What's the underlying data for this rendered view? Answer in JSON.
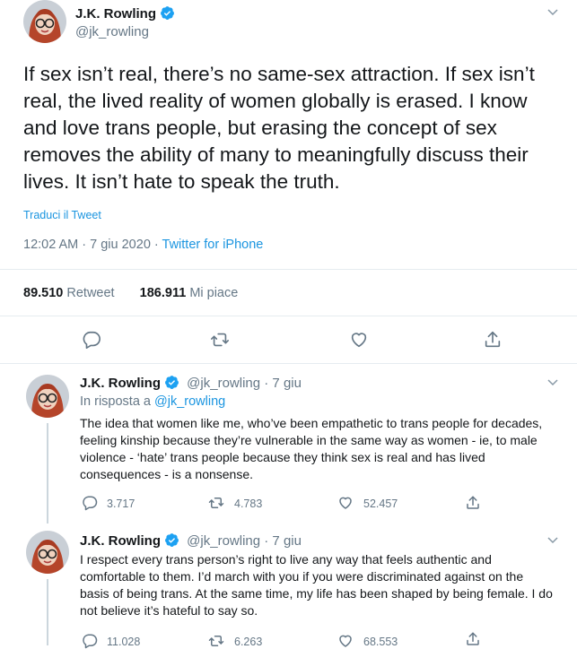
{
  "main_tweet": {
    "author_name": "J.K. Rowling",
    "author_handle": "@jk_rowling",
    "text": "If sex isn’t real, there’s no same-sex attraction. If sex isn’t real, the lived reality of women globally is erased. I know and love trans people, but erasing the concept of sex removes the ability of many to meaningfully discuss their lives. It isn’t hate to speak the truth.",
    "translate_label": "Traduci il Tweet",
    "timestamp": "12:02 AM · 7 giu 2020",
    "meta_separator": " · ",
    "source": "Twitter for iPhone",
    "retweets_count": "89.510",
    "retweets_label": "Retweet",
    "likes_count": "186.911",
    "likes_label": "Mi piace"
  },
  "replies": [
    {
      "author_name": "J.K. Rowling",
      "author_handle": "@jk_rowling",
      "date": "· 7 giu",
      "reply_to_prefix": "In risposta a",
      "reply_to_handle": "@jk_rowling",
      "text": "The idea that women like me, who’ve been empathetic to trans people for decades, feeling kinship because they’re vulnerable in the same way as women - ie, to male violence - ‘hate’ trans people because they think sex is real and has lived consequences - is a nonsense.",
      "reply_count": "3.717",
      "retweet_count": "4.783",
      "like_count": "52.457"
    },
    {
      "author_name": "J.K. Rowling",
      "author_handle": "@jk_rowling",
      "date": "· 7 giu",
      "text": "I respect every trans person’s right to live any way that feels authentic and comfortable to them. I’d march with you if you were discriminated against on the basis of being trans. At the same time, my life has been shaped by being female. I do not believe it’s hateful to say so.",
      "reply_count": "11.028",
      "retweet_count": "6.263",
      "like_count": "68.553"
    }
  ],
  "colors": {
    "accent": "#1b95e0",
    "secondary_text": "#657786",
    "divider": "#e6ecf0"
  }
}
